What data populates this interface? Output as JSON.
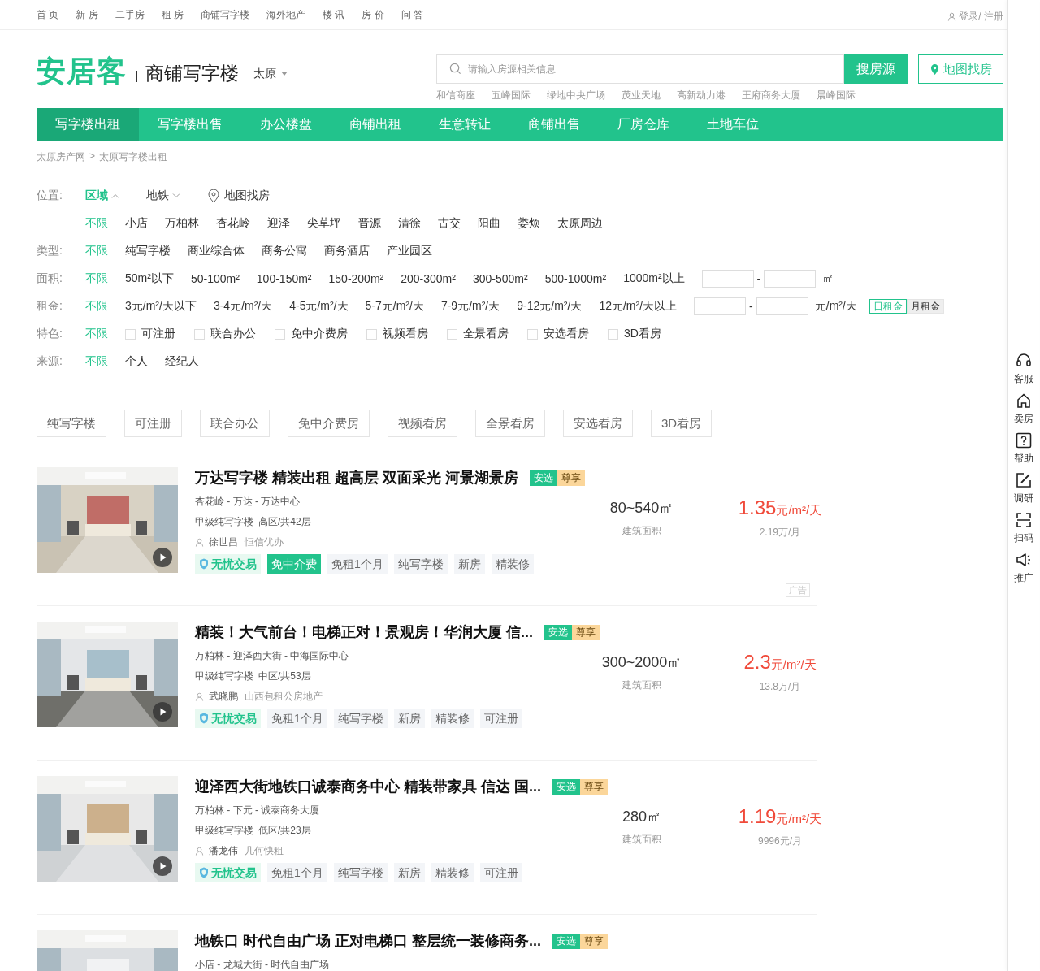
{
  "top_nav": {
    "items": [
      "首 页",
      "新 房",
      "二手房",
      "租 房",
      "商铺写字楼",
      "海外地产",
      "楼 讯",
      "房 价",
      "问 答"
    ],
    "login": "登录/ 注册"
  },
  "header": {
    "logo": "安居客",
    "channel": "商铺写字楼",
    "city": "太原",
    "search_placeholder": "请输入房源相关信息",
    "search_button": "搜房源",
    "map_button": "地图找房",
    "hot_words": [
      "和信商座",
      "五峰国际",
      "绿地中央广场",
      "茂业天地",
      "高新动力港",
      "王府商务大厦",
      "晨峰国际"
    ]
  },
  "main_nav": [
    {
      "label": "写字楼出租",
      "selected": true
    },
    {
      "label": "写字楼出售",
      "selected": false
    },
    {
      "label": "办公楼盘",
      "selected": false
    },
    {
      "label": "商铺出租",
      "selected": false
    },
    {
      "label": "生意转让",
      "selected": false
    },
    {
      "label": "商铺出售",
      "selected": false
    },
    {
      "label": "厂房仓库",
      "selected": false
    },
    {
      "label": "土地车位",
      "selected": false
    }
  ],
  "breadcrumb": {
    "items": [
      "太原房产网",
      "太原写字楼出租"
    ],
    "separator": ">"
  },
  "filters": [
    {
      "kind": "location",
      "label": "位置:",
      "tabs": [
        {
          "label": "区域",
          "selected": true,
          "expanded": true
        },
        {
          "label": "地铁",
          "selected": false,
          "expanded": false
        }
      ],
      "map_link": "地图找房"
    },
    {
      "kind": "options",
      "options": [
        {
          "label": "不限",
          "selected": true
        },
        {
          "label": "小店",
          "selected": false
        },
        {
          "label": "万柏林",
          "selected": false
        },
        {
          "label": "杏花岭",
          "selected": false
        },
        {
          "label": "迎泽",
          "selected": false
        },
        {
          "label": "尖草坪",
          "selected": false
        },
        {
          "label": "晋源",
          "selected": false
        },
        {
          "label": "清徐",
          "selected": false
        },
        {
          "label": "古交",
          "selected": false
        },
        {
          "label": "阳曲",
          "selected": false
        },
        {
          "label": "娄烦",
          "selected": false
        },
        {
          "label": "太原周边",
          "selected": false
        }
      ]
    },
    {
      "kind": "options",
      "label": "类型:",
      "options": [
        {
          "label": "不限",
          "selected": true
        },
        {
          "label": "纯写字楼",
          "selected": false
        },
        {
          "label": "商业综合体",
          "selected": false
        },
        {
          "label": "商务公寓",
          "selected": false
        },
        {
          "label": "商务酒店",
          "selected": false
        },
        {
          "label": "产业园区",
          "selected": false
        }
      ]
    },
    {
      "kind": "range",
      "label": "面积:",
      "options": [
        {
          "label": "不限",
          "selected": true
        },
        {
          "label": "50m²以下",
          "selected": false
        },
        {
          "label": "50-100m²",
          "selected": false
        },
        {
          "label": "100-150m²",
          "selected": false
        },
        {
          "label": "150-200m²",
          "selected": false
        },
        {
          "label": "200-300m²",
          "selected": false
        },
        {
          "label": "300-500m²",
          "selected": false
        },
        {
          "label": "500-1000m²",
          "selected": false
        },
        {
          "label": "1000m²以上",
          "selected": false
        }
      ],
      "dash": "-",
      "unit": "㎡"
    },
    {
      "kind": "range",
      "label": "租金:",
      "options": [
        {
          "label": "不限",
          "selected": true
        },
        {
          "label": "3元/m²/天以下",
          "selected": false
        },
        {
          "label": "3-4元/m²/天",
          "selected": false
        },
        {
          "label": "4-5元/m²/天",
          "selected": false
        },
        {
          "label": "5-7元/m²/天",
          "selected": false
        },
        {
          "label": "7-9元/m²/天",
          "selected": false
        },
        {
          "label": "9-12元/m²/天",
          "selected": false
        },
        {
          "label": "12元/m²/天以上",
          "selected": false
        }
      ],
      "dash": "-",
      "unit": "元/m²/天",
      "toggle": [
        {
          "label": "日租金",
          "selected": true
        },
        {
          "label": "月租金",
          "selected": false
        }
      ]
    },
    {
      "kind": "checkboxes",
      "label": "特色:",
      "options": [
        {
          "label": "不限",
          "selected": true
        },
        {
          "label": "可注册",
          "checked": false
        },
        {
          "label": "联合办公",
          "checked": false
        },
        {
          "label": "免中介费房",
          "checked": false
        },
        {
          "label": "视频看房",
          "checked": false
        },
        {
          "label": "全景看房",
          "checked": false
        },
        {
          "label": "安选看房",
          "checked": false
        },
        {
          "label": "3D看房",
          "checked": false
        }
      ]
    },
    {
      "kind": "options",
      "label": "来源:",
      "options": [
        {
          "label": "不限",
          "selected": true
        },
        {
          "label": "个人",
          "selected": false
        },
        {
          "label": "经纪人",
          "selected": false
        }
      ]
    }
  ],
  "quick_tags": [
    "纯写字楼",
    "可注册",
    "联合办公",
    "免中介费房",
    "视频看房",
    "全景看房",
    "安选看房",
    "3D看房"
  ],
  "listings": [
    {
      "title": "万达写字楼 精装出租 超高层 双面采光 河景湖景房",
      "badges": [
        "安选",
        "尊享"
      ],
      "location": "杏花岭 - 万达 - 万达中心",
      "grade": "甲级纯写字楼",
      "floor": "高区/共42层",
      "agent": "徐世昌",
      "company": "恒信优办",
      "tags": [
        {
          "kind": "guarantee",
          "label": "无忧交易"
        },
        {
          "kind": "highlight",
          "label": "免中介费"
        },
        {
          "kind": "plain",
          "label": "免租1个月"
        },
        {
          "kind": "plain",
          "label": "纯写字楼"
        },
        {
          "kind": "plain",
          "label": "新房"
        },
        {
          "kind": "plain",
          "label": "精装修"
        }
      ],
      "area": "80~540㎡",
      "area_label": "建筑面积",
      "price": "1.35",
      "price_unit": "元/m²/天",
      "monthly": "2.19万/月",
      "video": true,
      "ad": "广告"
    },
    {
      "title": "精装！大气前台！电梯正对！景观房！华润大厦 信...",
      "badges": [
        "安选",
        "尊享"
      ],
      "location": "万柏林 - 迎泽西大街 - 中海国际中心",
      "grade": "甲级纯写字楼",
      "floor": "中区/共53层",
      "agent": "武晓鹏",
      "company": "山西包租公房地产",
      "tags": [
        {
          "kind": "guarantee",
          "label": "无忧交易"
        },
        {
          "kind": "plain",
          "label": "免租1个月"
        },
        {
          "kind": "plain",
          "label": "纯写字楼"
        },
        {
          "kind": "plain",
          "label": "新房"
        },
        {
          "kind": "plain",
          "label": "精装修"
        },
        {
          "kind": "plain",
          "label": "可注册"
        }
      ],
      "area": "300~2000㎡",
      "area_label": "建筑面积",
      "price": "2.3",
      "price_unit": "元/m²/天",
      "monthly": "13.8万/月",
      "video": true
    },
    {
      "title": "迎泽西大街地铁口诚泰商务中心 精装带家具 信达 国...",
      "badges": [
        "安选",
        "尊享"
      ],
      "location": "万柏林 - 下元 - 诚泰商务大厦",
      "grade": "甲级纯写字楼",
      "floor": "低区/共23层",
      "agent": "潘龙伟",
      "company": "几何快租",
      "tags": [
        {
          "kind": "guarantee",
          "label": "无忧交易"
        },
        {
          "kind": "plain",
          "label": "免租1个月"
        },
        {
          "kind": "plain",
          "label": "纯写字楼"
        },
        {
          "kind": "plain",
          "label": "新房"
        },
        {
          "kind": "plain",
          "label": "精装修"
        },
        {
          "kind": "plain",
          "label": "可注册"
        }
      ],
      "area": "280㎡",
      "area_label": "建筑面积",
      "price": "1.19",
      "price_unit": "元/m²/天",
      "monthly": "9996元/月",
      "video": true
    },
    {
      "title": "地铁口 时代自由广场 正对电梯口 整层统一装修商务...",
      "badges": [
        "安选",
        "尊享"
      ],
      "location": "小店 - 龙城大街 - 时代自由广场"
    }
  ],
  "side_tools": [
    {
      "kind": "headset",
      "label": "客服"
    },
    {
      "kind": "house",
      "label": "卖房"
    },
    {
      "kind": "help",
      "label": "帮助"
    },
    {
      "kind": "edit",
      "label": "调研"
    },
    {
      "kind": "scan",
      "label": "扫码"
    },
    {
      "kind": "speaker",
      "label": "推广"
    }
  ]
}
